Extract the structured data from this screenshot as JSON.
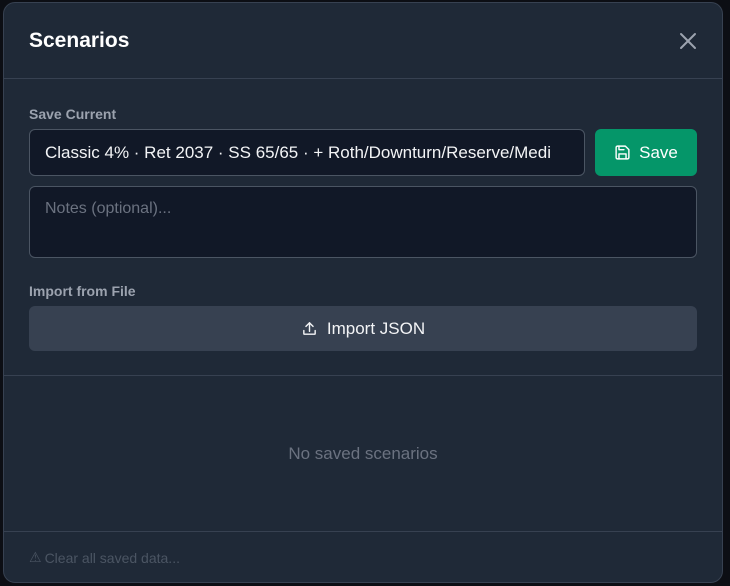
{
  "modal": {
    "title": "Scenarios",
    "close_icon": "close-icon"
  },
  "save_current": {
    "label": "Save Current",
    "name_value": "Classic 4% · Ret 2037 · SS 65/65 · + Roth/Downturn/Reserve/Medi",
    "save_label": "Save",
    "save_icon": "floppy-disk-icon",
    "notes_placeholder": "Notes (optional)..."
  },
  "import": {
    "label": "Import from File",
    "button_label": "Import JSON",
    "icon": "upload-icon"
  },
  "saved": {
    "empty_text": "No saved scenarios"
  },
  "footer": {
    "warning_glyph": "⚠",
    "clear_label": "Clear all saved data..."
  },
  "colors": {
    "modal_bg": "#1f2937",
    "input_bg": "#111827",
    "save_button": "#059669",
    "import_button": "#374151"
  }
}
